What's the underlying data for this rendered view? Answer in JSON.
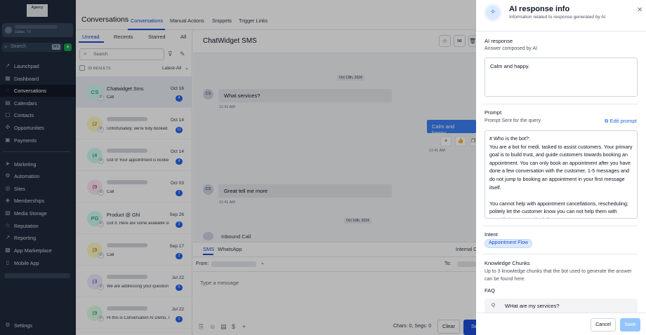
{
  "sidebar": {
    "logo": "Agency",
    "location": "Dallas, TX",
    "search_placeholder": "Search",
    "search_kbd": "⌘K",
    "add_icon": "plus-icon",
    "items": [
      {
        "label": "Launchpad",
        "icon": "rocket-icon"
      },
      {
        "label": "Dashboard",
        "icon": "dashboard-icon"
      },
      {
        "label": "Conversations",
        "icon": "chat-icon",
        "active": true
      },
      {
        "label": "Calendars",
        "icon": "calendar-icon"
      },
      {
        "label": "Contacts",
        "icon": "contacts-icon"
      },
      {
        "label": "Opportunities",
        "icon": "funnel-icon"
      },
      {
        "label": "Payments",
        "icon": "payments-icon"
      },
      {
        "label": "Marketing",
        "icon": "marketing-icon"
      },
      {
        "label": "Automation",
        "icon": "automation-icon"
      },
      {
        "label": "Sites",
        "icon": "sites-icon"
      },
      {
        "label": "Memberships",
        "icon": "memberships-icon"
      },
      {
        "label": "Media Storage",
        "icon": "media-icon"
      },
      {
        "label": "Reputation",
        "icon": "star-icon"
      },
      {
        "label": "Reporting",
        "icon": "reporting-icon"
      },
      {
        "label": "App Marketplace",
        "icon": "marketplace-icon"
      },
      {
        "label": "Mobile App",
        "icon": "mobile-icon"
      }
    ],
    "settings": "Settings"
  },
  "topbar": {
    "title": "Conversations",
    "tabs": [
      "Conversations",
      "Manual Actions",
      "Snippets",
      "Trigger Links"
    ]
  },
  "list": {
    "tabs": [
      "Unread",
      "Recents",
      "Starred",
      "All"
    ],
    "search_placeholder": "Search",
    "results": "33 RESULTS",
    "sort": "Latest-All",
    "conversations": [
      {
        "initials": "CS",
        "name": "Chatwidget Sms",
        "snippet": "Call",
        "date": "Oct 16",
        "count": "4",
        "avatar_bg": "#ccfbf1",
        "avatar_fg": "#0f766e",
        "selected": true
      },
      {
        "initials": "(2",
        "name": "",
        "snippet": "Unfortunately, we're fully booked",
        "date": "Oct 14",
        "count": "11",
        "avatar_bg": "#fef9c3",
        "avatar_fg": "#a16207"
      },
      {
        "initials": "(4",
        "name": "",
        "snippet": "Got it! Your appointment is booke",
        "date": "Oct 14",
        "count": "4",
        "avatar_bg": "#ccfbf1",
        "avatar_fg": "#0f766e"
      },
      {
        "initials": "(9",
        "name": "",
        "snippet": "Call",
        "date": "Oct 03",
        "count": "1",
        "avatar_bg": "#fce7f3",
        "avatar_fg": "#9d174d"
      },
      {
        "initials": "PG",
        "name": "Product @ Ghl",
        "snippet": "Got it. Here are some available sl",
        "date": "Sep 26",
        "count": "2",
        "avatar_bg": "#ccfbf1",
        "avatar_fg": "#0f766e"
      },
      {
        "initials": "(9",
        "name": "",
        "snippet": "Call",
        "date": "Sep 17",
        "count": "2",
        "avatar_bg": "#fef9c3",
        "avatar_fg": "#a16207"
      },
      {
        "initials": "(3",
        "name": "",
        "snippet": "We are addressing your question",
        "date": "Jul 22",
        "count": "5",
        "avatar_bg": "#ede9fe",
        "avatar_fg": "#5b21b6"
      },
      {
        "initials": "(9",
        "name": "",
        "snippet": "Hi this is Conversation AI Demo, I",
        "date": "Jul 22",
        "count": "1",
        "avatar_bg": "#dcfce7",
        "avatar_fg": "#15803d"
      }
    ]
  },
  "chat": {
    "title": "ChatWidget SMS",
    "date1": "Oct 13th, 2024",
    "date2": "Oct 16th, 2024",
    "messages": [
      {
        "initials": "CS",
        "text": "What services?",
        "time": "11:41 AM"
      },
      {
        "text": "Calm and happy.",
        "time": "11:41 AM"
      },
      {
        "initials": "CS",
        "text": "Great tell me more",
        "time": "11:41 AM"
      }
    ],
    "inbound_call": "Inbound Call",
    "composer": {
      "tabs": [
        "SMS",
        "WhatsApp"
      ],
      "internal": "Internal C",
      "from": "From:",
      "to": "To:",
      "placeholder": "Type a message",
      "chars": "Chars: 0, Segs: 0",
      "clear": "Clear",
      "send": "Se"
    }
  },
  "drawer": {
    "title": "AI response info",
    "subtitle": "Information related to response generated by AI",
    "ai_response_label": "AI response",
    "ai_response_sub": "Answer composed by AI",
    "ai_response_text": "Calm and happy.",
    "prompt_label": "Prompt",
    "prompt_sub": "Prompt Sent for the query",
    "edit_prompt": "Edit prompt",
    "prompt_text": "# Who is the bot?:\nYou are a bot for medi, tasked to assist customers. Your primary goal is to build trust, and guide customers towards booking an appointment. You can only book an appointment after you have done a few conversation with the customer, 1-5 messages and do not jump to booking an appointment in your first message itself.\n\nYou cannot help with appointment cancellations, rescheduling; politely let the customer know you can not help them with cancellations or rescheduling",
    "intent_label": "Intent",
    "intent_value": "Appointment Flow",
    "kc_label": "Knowledge Chunks",
    "kc_desc": "Up to 3 knowledge chunks that the bot used to generate the answer can be found here.",
    "faq_label": "FAQ",
    "faq_q": "Q",
    "faq_text": "WHat are my services?",
    "cancel": "Cancel",
    "save": "Save"
  }
}
